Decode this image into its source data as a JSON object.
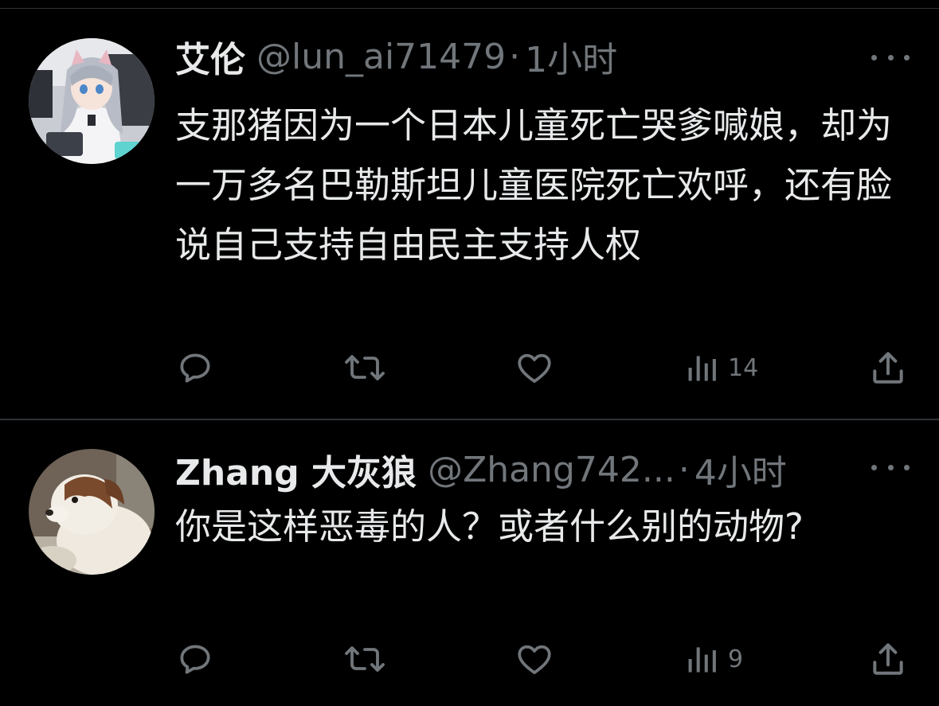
{
  "colors": {
    "background": "#000000",
    "primary_text": "#e7e9ea",
    "secondary_text": "#71767b",
    "divider": "#2f3336"
  },
  "tweets": [
    {
      "display_name": "艾伦",
      "handle": "@lun_ai71479",
      "separator": "·",
      "time": "1小时",
      "text": "支那猪因为一个日本儿童死亡哭爹喊娘，却为一万多名巴勒斯坦儿童医院死亡欢呼，还有脸说自己支持自由民主支持人权",
      "avatar": "anime-girl-avatar",
      "views": "14"
    },
    {
      "display_name": "Zhang 大灰狼",
      "handle": "@Zhang742...",
      "separator": "·",
      "time": "4小时",
      "text": "你是这样恶毒的人？或者什么别的动物?",
      "avatar": "puppy-avatar",
      "views": "9"
    }
  ],
  "icons": {
    "reply": "reply-icon",
    "retweet": "retweet-icon",
    "like": "heart-icon",
    "views": "views-icon",
    "share": "share-icon",
    "more": "more-icon"
  }
}
